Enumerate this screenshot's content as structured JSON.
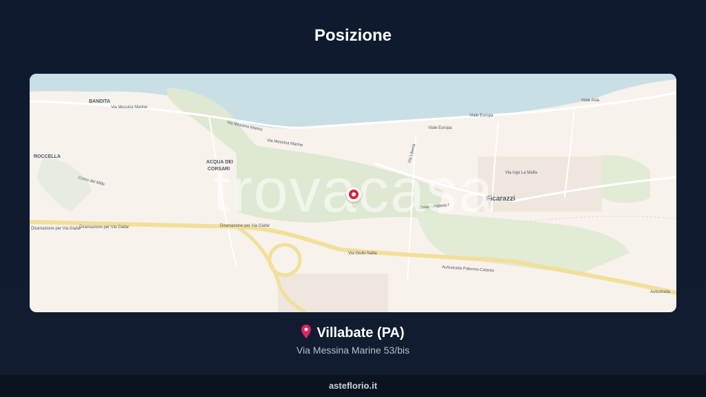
{
  "page": {
    "title": "Posizione"
  },
  "map": {
    "watermark": "trovacasa",
    "labels": {
      "bandita": "BANDITA",
      "roccella": "ROCCELLA",
      "acqua_dei_corsari_1": "ACQUA DEI",
      "acqua_dei_corsari_2": "CORSARI",
      "ficarazzi": "Ficarazzi",
      "via_messina_marine_1": "Via Messina Marine",
      "via_messina_marine_2": "Via Messina Marine",
      "via_messina_marine_3": "Via Messina Marine",
      "viale_europa_1": "Viale Europa",
      "viale_europa_2": "Viale Europa",
      "diramazione_1": "Diramazione per Via Giafar",
      "diramazione_2": "Diramazione per Via Giafar",
      "diramazione_3": "Diramazione per Via Giafar",
      "autostrada_1": "Autostrada Palermo-Catania",
      "autostrada_2": "Autostrada",
      "corso_umberto": "Corso Umberto I",
      "via_giulio_natta": "Via Giulio Natta",
      "corso_dei_mille": "Corso dei Mille",
      "via_libert": "Via Libertà",
      "via_ugo_la_malfa": "Via Ugo La Malfa",
      "viale_asia": "Viale Asia"
    }
  },
  "location": {
    "city": "Villabate (PA)",
    "address": "Via Messina Marine 53/bis"
  },
  "footer": {
    "site": "asteflorio.it"
  },
  "colors": {
    "background": "#0f1a2e",
    "marker": "#d6243a",
    "sea": "#c9dfe6",
    "land": "#f8f2ec",
    "park": "#dfe8d2",
    "highway": "#f2df9a"
  }
}
